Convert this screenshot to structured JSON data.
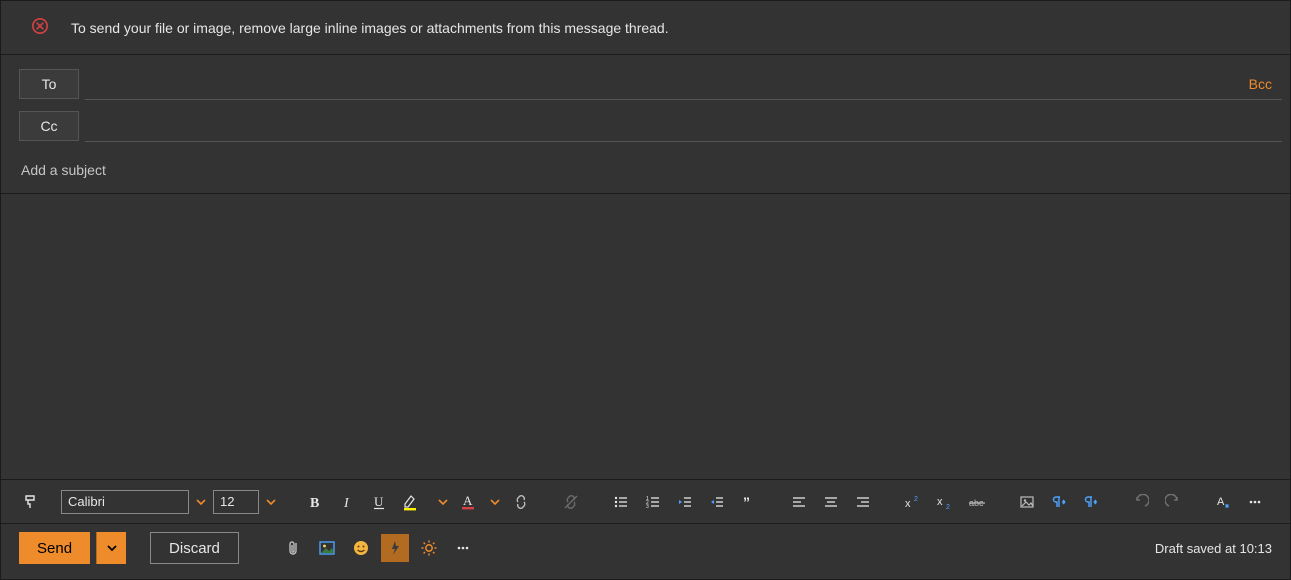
{
  "notification": {
    "message": "To send your file or image, remove large inline images or attachments from this message thread."
  },
  "fields": {
    "to_label": "To",
    "cc_label": "Cc",
    "bcc_label": "Bcc",
    "to_value": "",
    "cc_value": "",
    "subject_placeholder": "Add a subject",
    "subject_value": ""
  },
  "format_toolbar": {
    "font_name": "Calibri",
    "font_size": "12"
  },
  "action_toolbar": {
    "send_label": "Send",
    "discard_label": "Discard"
  },
  "status": {
    "draft_saved": "Draft saved at 10:13"
  },
  "colors": {
    "accent": "#ee8b2b",
    "error": "#d84141",
    "highlight_underline": "#fff200",
    "fontcolor_underline": "#d84141",
    "link": "#4da3ff"
  }
}
